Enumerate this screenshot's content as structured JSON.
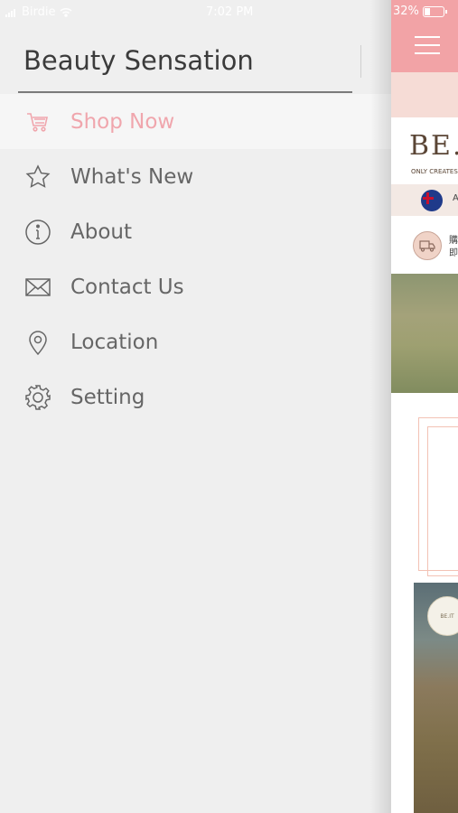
{
  "status_bar": {
    "carrier": "Birdie",
    "time": "7:02 PM",
    "battery": "32%",
    "battery_level": 0.32
  },
  "drawer": {
    "title": "Beauty Sensation",
    "menu": [
      {
        "label": "Shop Now",
        "icon": "cart-icon",
        "active": true
      },
      {
        "label": "What's New",
        "icon": "star-icon",
        "active": false
      },
      {
        "label": "About",
        "icon": "info-icon",
        "active": false
      },
      {
        "label": "Contact Us",
        "icon": "envelope-icon",
        "active": false
      },
      {
        "label": "Location",
        "icon": "location-pin-icon",
        "active": false
      },
      {
        "label": "Setting",
        "icon": "gear-icon",
        "active": false
      }
    ]
  },
  "app_preview": {
    "logo": "BE.",
    "logo_tagline": "ONLY CREATES",
    "flag_text": "A",
    "ship_text": [
      "購",
      "即"
    ],
    "badge_text": "BE.IT"
  },
  "colors": {
    "accent": "#f0a6ad",
    "header": "#f2a3a6",
    "drawer_bg": "#efefef"
  }
}
